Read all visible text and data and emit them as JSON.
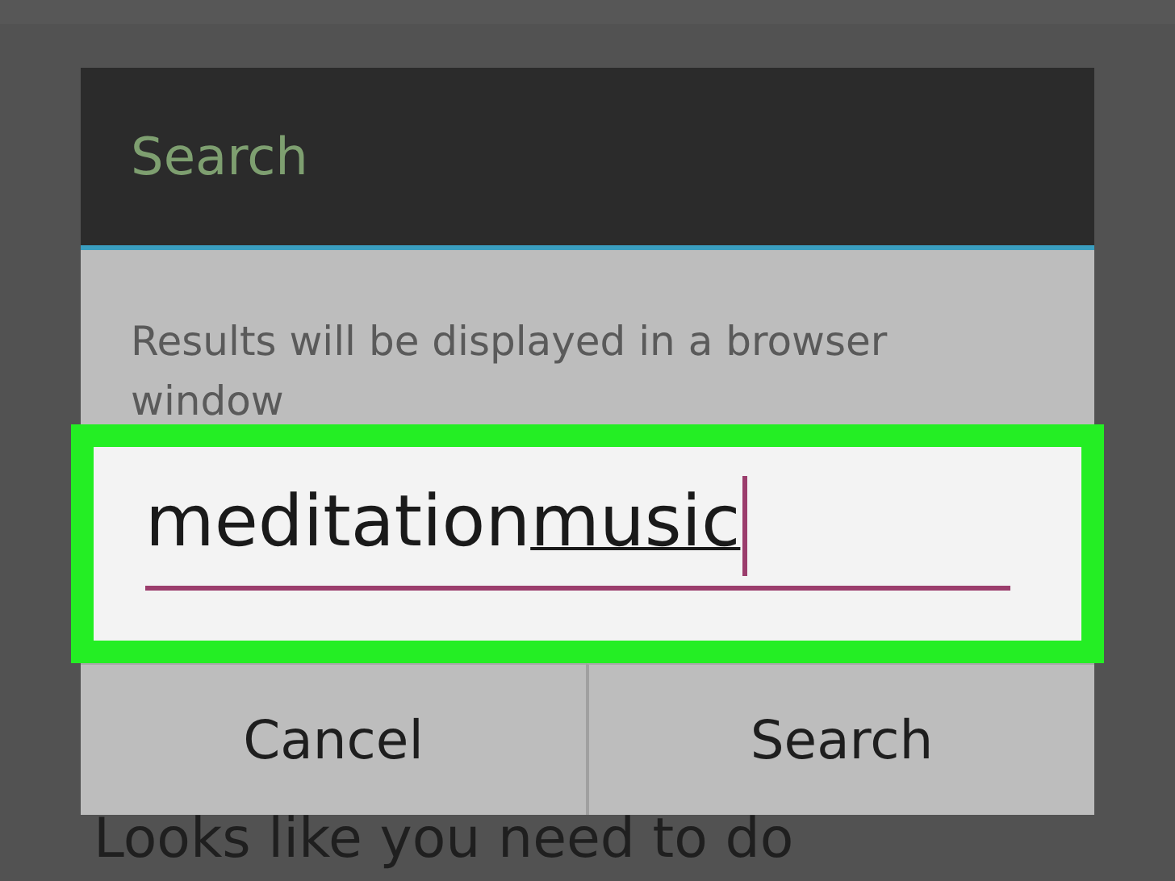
{
  "background": {
    "text": "Looks like you need to do"
  },
  "dialog": {
    "title": "Search",
    "message": "Results will be displayed in a browser window",
    "search_field": {
      "highlighted": true,
      "focused": true,
      "words": [
        {
          "text": "meditation",
          "underlined": false
        },
        {
          "text": "music",
          "underlined": true
        }
      ]
    },
    "buttons": [
      "Cancel",
      "Search"
    ]
  }
}
